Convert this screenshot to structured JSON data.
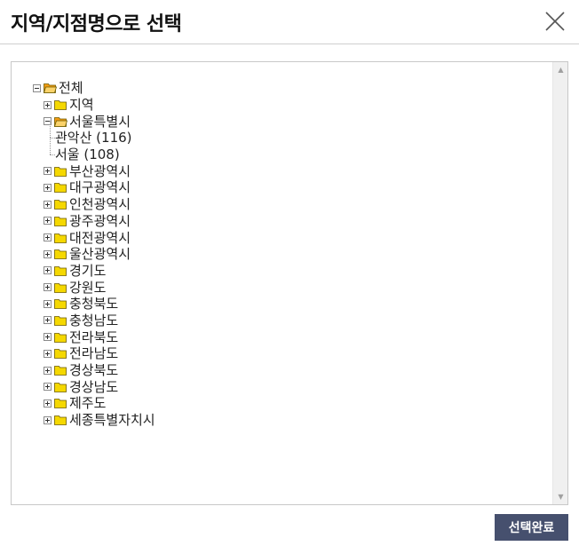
{
  "dialog": {
    "title": "지역/지점명으로 선택",
    "confirm_label": "선택완료"
  },
  "tree": {
    "root": {
      "label": "전체",
      "expanded": true
    },
    "nodes": [
      {
        "label": "지역",
        "expanded": false
      },
      {
        "label": "서울특별시",
        "expanded": true,
        "children": [
          {
            "label": "관악산 (116)"
          },
          {
            "label": "서울 (108)"
          }
        ]
      },
      {
        "label": "부산광역시",
        "expanded": false
      },
      {
        "label": "대구광역시",
        "expanded": false
      },
      {
        "label": "인천광역시",
        "expanded": false
      },
      {
        "label": "광주광역시",
        "expanded": false
      },
      {
        "label": "대전광역시",
        "expanded": false
      },
      {
        "label": "울산광역시",
        "expanded": false
      },
      {
        "label": "경기도",
        "expanded": false
      },
      {
        "label": "강원도",
        "expanded": false
      },
      {
        "label": "충청북도",
        "expanded": false
      },
      {
        "label": "충청남도",
        "expanded": false
      },
      {
        "label": "전라북도",
        "expanded": false
      },
      {
        "label": "전라남도",
        "expanded": false
      },
      {
        "label": "경상북도",
        "expanded": false
      },
      {
        "label": "경상남도",
        "expanded": false
      },
      {
        "label": "제주도",
        "expanded": false
      },
      {
        "label": "세종특별자치시",
        "expanded": false
      }
    ]
  },
  "colors": {
    "folder_closed": "#f5d800",
    "folder_open": "#f39c12",
    "button_bg": "#46506e"
  }
}
